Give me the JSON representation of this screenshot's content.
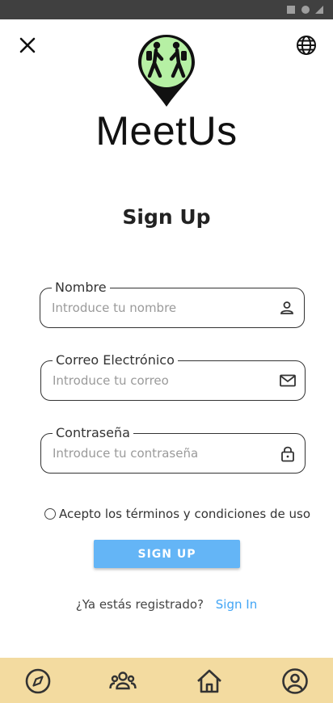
{
  "app": {
    "name": "MeetUs"
  },
  "page": {
    "title": "Sign Up"
  },
  "form": {
    "name": {
      "label": "Nombre",
      "placeholder": "Introduce tu nombre",
      "value": ""
    },
    "email": {
      "label": "Correo Electrónico",
      "placeholder": "Introduce tu correo",
      "value": ""
    },
    "password": {
      "label": "Contraseña",
      "placeholder": "Introduce tu contraseña",
      "value": ""
    },
    "terms_label": "Acepto los términos y condiciones de uso",
    "submit_label": "SIGN UP"
  },
  "signin": {
    "question": "¿Ya estás registrado?",
    "link": "Sign In"
  },
  "icons": {
    "close": "close-icon",
    "language": "globe-icon",
    "name_field": "person-icon",
    "email_field": "mail-icon",
    "password_field": "lock-icon"
  },
  "bottom_nav": [
    {
      "icon": "compass-icon"
    },
    {
      "icon": "groups-icon"
    },
    {
      "icon": "home-icon"
    },
    {
      "icon": "account-circle-icon"
    }
  ],
  "colors": {
    "accent": "#64b5f6",
    "link": "#42a5f5",
    "nav_background": "#f3dba0",
    "logo_fill": "#b6f0a4",
    "status_bar": "#404040"
  }
}
